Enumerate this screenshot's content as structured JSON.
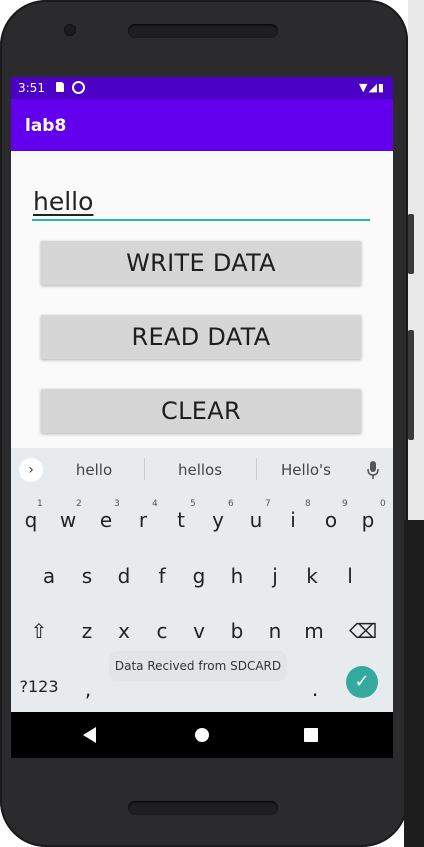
{
  "status_bar": {
    "time": "3:51",
    "right_icons": "▼◢▮"
  },
  "app_bar": {
    "title": "lab8"
  },
  "input": {
    "value": "hello"
  },
  "buttons": {
    "write": "WRITE DATA",
    "read": "READ DATA",
    "clear": "CLEAR"
  },
  "keyboard": {
    "toggle": "›",
    "suggestions": [
      "hello",
      "hellos",
      "Hello's"
    ],
    "row1": [
      "q",
      "w",
      "e",
      "r",
      "t",
      "y",
      "u",
      "i",
      "o",
      "p"
    ],
    "row1_hints": [
      "1",
      "2",
      "3",
      "4",
      "5",
      "6",
      "7",
      "8",
      "9",
      "0"
    ],
    "row2": [
      "a",
      "s",
      "d",
      "f",
      "g",
      "h",
      "j",
      "k",
      "l"
    ],
    "row3": [
      "⇧",
      "z",
      "x",
      "c",
      "v",
      "b",
      "n",
      "m",
      "⌫"
    ],
    "row4": {
      "symbols": "?123",
      "comma": ",",
      "period": ".",
      "enter": "✓"
    }
  },
  "toast": "Data Recived from SDCARD",
  "colors": {
    "primary": "#6200ee",
    "status": "#4b00c6",
    "accent": "#26b5a7",
    "button": "#d6d6d6"
  }
}
